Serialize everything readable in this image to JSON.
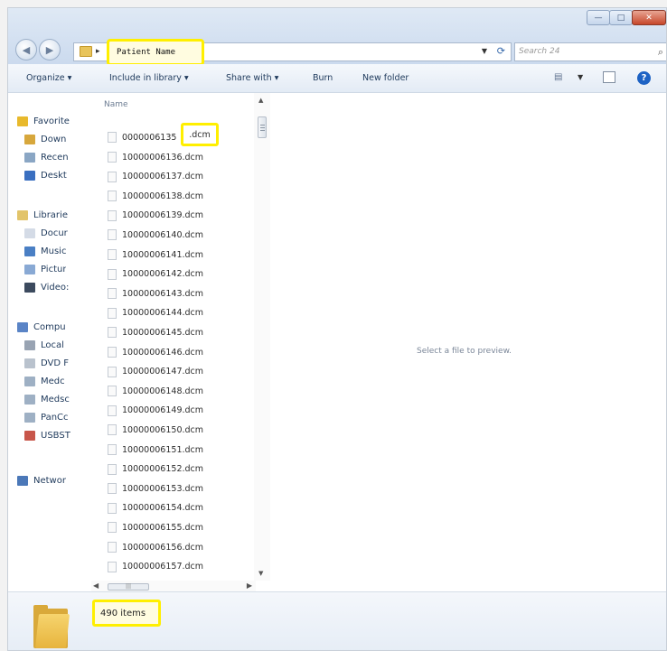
{
  "window": {
    "controls": {
      "minimize": "—",
      "maximize": "□",
      "close": "✕"
    }
  },
  "address": {
    "path": "Patient Name",
    "separator": "▸"
  },
  "search": {
    "placeholder": "Search 24"
  },
  "toolbar": {
    "organize": "Organize ▾",
    "include_in_library": "Include in library ▾",
    "share_with": "Share with ▾",
    "burn": "Burn",
    "new_folder": "New folder"
  },
  "nav": {
    "items": [
      {
        "label": "Favorite",
        "icon": "star-icon",
        "color": "#e8b92c"
      },
      {
        "label": "Down",
        "icon": "downloads-icon",
        "color": "#d7a73c"
      },
      {
        "label": "Recen",
        "icon": "recent-places-icon",
        "color": "#8aa6c4"
      },
      {
        "label": "Deskt",
        "icon": "desktop-icon",
        "color": "#3a6fc0"
      },
      {
        "label": "Librarie",
        "icon": "libraries-icon",
        "color": "#e2c46a"
      },
      {
        "label": "Docur",
        "icon": "documents-icon",
        "color": "#d4dbe6"
      },
      {
        "label": "Music",
        "icon": "music-icon",
        "color": "#4a7fc4"
      },
      {
        "label": "Pictur",
        "icon": "pictures-icon",
        "color": "#89a9d4"
      },
      {
        "label": "Video:",
        "icon": "videos-icon",
        "color": "#3c4a5e"
      },
      {
        "label": "Compu",
        "icon": "computer-icon",
        "color": "#5a84c6"
      },
      {
        "label": "Local",
        "icon": "local-disk-icon",
        "color": "#98a3b2"
      },
      {
        "label": "DVD F",
        "icon": "dvd-drive-icon",
        "color": "#b9c2cd"
      },
      {
        "label": "Medc",
        "icon": "network-drive-icon",
        "color": "#9eb0c4"
      },
      {
        "label": "Medsc",
        "icon": "network-drive-icon",
        "color": "#9eb0c4"
      },
      {
        "label": "PanCc",
        "icon": "network-drive-icon",
        "color": "#9eb0c4"
      },
      {
        "label": "USBST",
        "icon": "usb-drive-icon",
        "color": "#c8564a"
      },
      {
        "label": "Networ",
        "icon": "network-icon",
        "color": "#4b78b8"
      }
    ]
  },
  "files": {
    "column_header": "Name",
    "first_prefix": "0000006135",
    "first_ext": ".dcm",
    "items": [
      "10000006136.dcm",
      "10000006137.dcm",
      "10000006138.dcm",
      "10000006139.dcm",
      "10000006140.dcm",
      "10000006141.dcm",
      "10000006142.dcm",
      "10000006143.dcm",
      "10000006144.dcm",
      "10000006145.dcm",
      "10000006146.dcm",
      "10000006147.dcm",
      "10000006148.dcm",
      "10000006149.dcm",
      "10000006150.dcm",
      "10000006151.dcm",
      "10000006152.dcm",
      "10000006153.dcm",
      "10000006154.dcm",
      "10000006155.dcm",
      "10000006156.dcm",
      "10000006157.dcm"
    ]
  },
  "preview": {
    "message": "Select a file to preview."
  },
  "details": {
    "item_count": "490 items"
  }
}
